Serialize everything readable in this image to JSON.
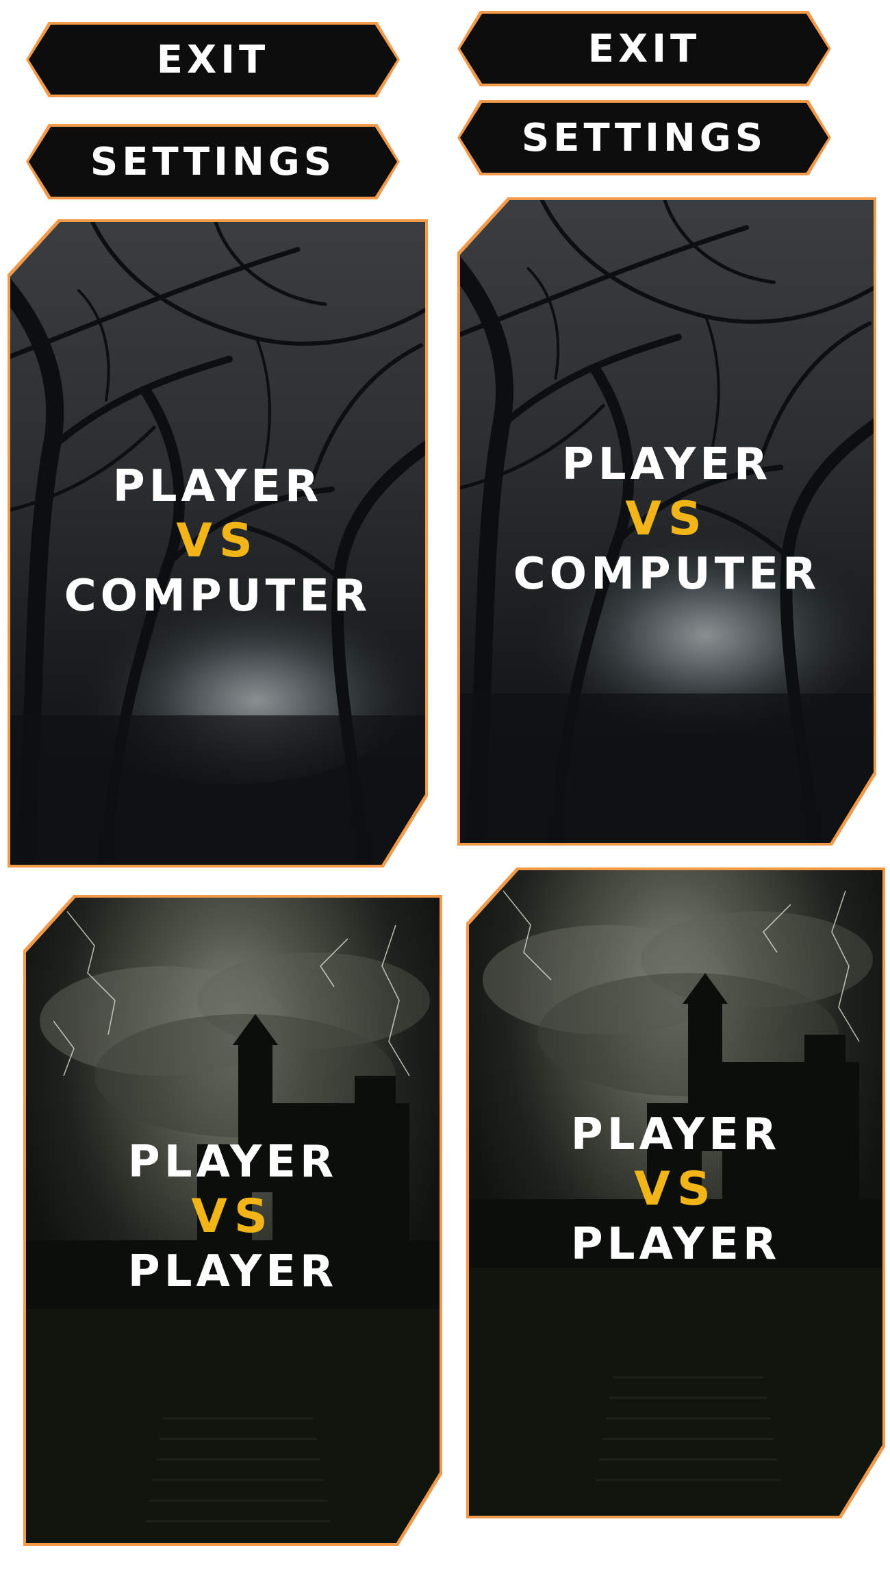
{
  "left_column": {
    "exit_label": "EXIT",
    "settings_label": "SETTINGS"
  },
  "right_column": {
    "exit_label": "EXIT",
    "settings_label": "SETTINGS"
  },
  "cards": {
    "pvc_1": {
      "line1": "PLAYER",
      "vs": "VS",
      "line2": "COMPUTER"
    },
    "pvc_2": {
      "line1": "PLAYER",
      "vs": "VS",
      "line2": "COMPUTER"
    },
    "pvp_1": {
      "line1": "PLAYER",
      "vs": "VS",
      "line2": "PLAYER"
    },
    "pvp_2": {
      "line1": "PLAYER",
      "vs": "VS",
      "line2": "PLAYER"
    }
  },
  "colors": {
    "border_orange": "#f29a4a",
    "button_fill": "#0d0d0d",
    "vs_yellow": "#f2b517",
    "text_white": "#ffffff"
  },
  "icons": {
    "forest_background": "dark-forest-trees",
    "castle_background": "castle-lightning-stairs"
  }
}
